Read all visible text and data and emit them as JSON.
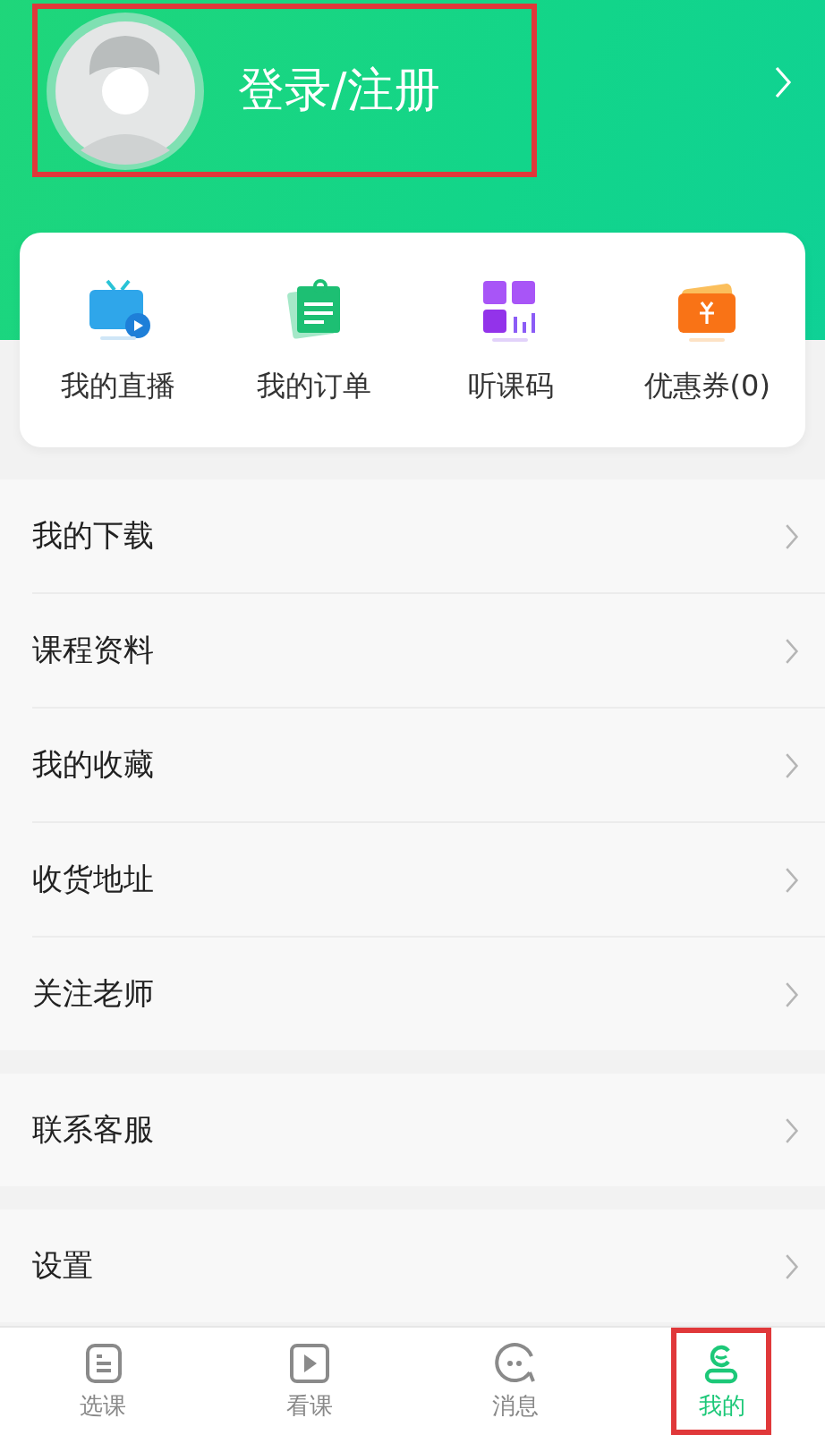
{
  "profile": {
    "login_text": "登录/注册",
    "highlighted": true
  },
  "shortcuts": [
    {
      "kind": "live",
      "label": "我的直播"
    },
    {
      "kind": "order",
      "label": "我的订单"
    },
    {
      "kind": "code",
      "label": "听课码"
    },
    {
      "kind": "coupon",
      "label": "优惠券(0)"
    }
  ],
  "menu_groups": [
    [
      "我的下载",
      "课程资料",
      "我的收藏",
      "收货地址",
      "关注老师"
    ],
    [
      "联系客服"
    ],
    [
      "设置"
    ]
  ],
  "tabs": [
    {
      "kind": "courses",
      "label": "选课",
      "selected": false,
      "highlighted": false
    },
    {
      "kind": "watch",
      "label": "看课",
      "selected": false,
      "highlighted": false
    },
    {
      "kind": "messages",
      "label": "消息",
      "selected": false,
      "highlighted": false
    },
    {
      "kind": "me",
      "label": "我的",
      "selected": true,
      "highlighted": true
    }
  ]
}
